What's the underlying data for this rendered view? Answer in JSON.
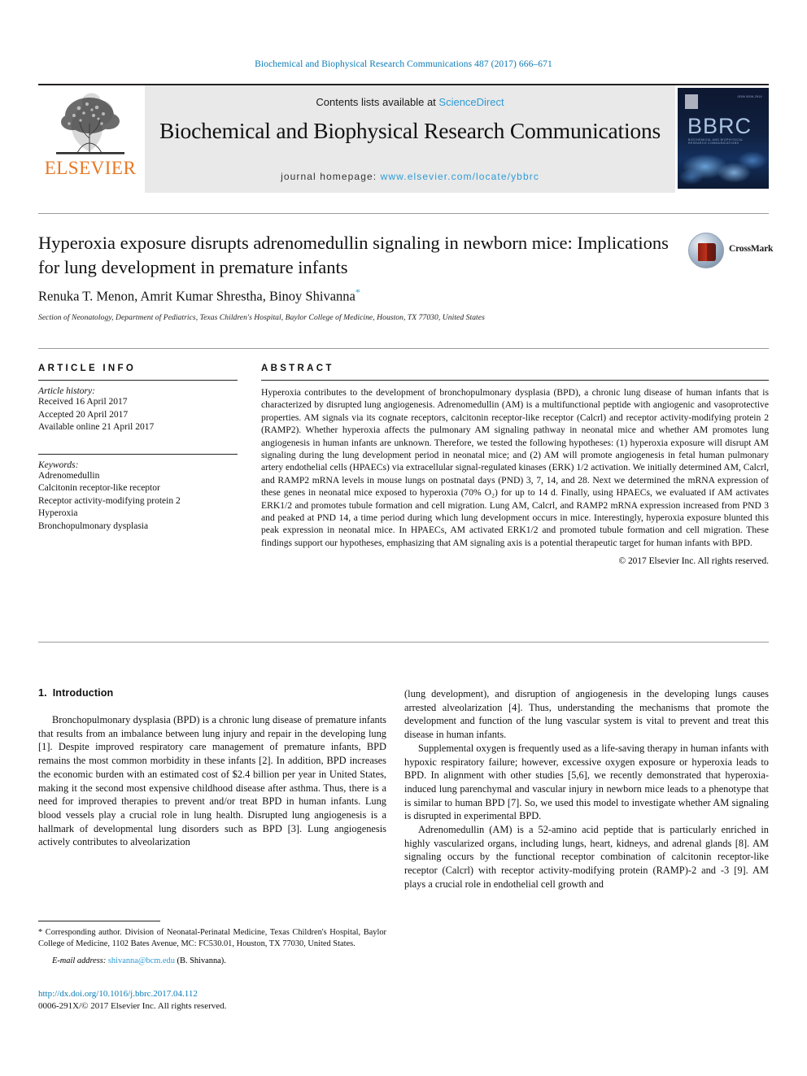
{
  "running_head": "Biochemical and Biophysical Research Communications 487 (2017) 666–671",
  "masthead": {
    "publisher_name": "ELSEVIER",
    "contents_prefix": "Contents lists available at ",
    "sciencedirect": "ScienceDirect",
    "journal_title": "Biochemical and Biophysical Research Communications",
    "homepage_prefix": "journal homepage: ",
    "homepage_url": "www.elsevier.com/locate/ybbrc",
    "cover": {
      "acronym": "BBRC",
      "subtitle": "BIOCHEMICAL AND BIOPHYSICAL RESEARCH COMMUNICATIONS",
      "corner_note": "ISSN 0006-291X"
    }
  },
  "article": {
    "title": "Hyperoxia exposure disrupts adrenomedullin signaling in newborn mice: Implications for lung development in premature infants",
    "authors": "Renuka T. Menon, Amrit Kumar Shrestha, Binoy Shivanna",
    "corresponding_marker": "*",
    "affiliation": "Section of Neonatology, Department of Pediatrics, Texas Children's Hospital, Baylor College of Medicine, Houston, TX 77030, United States",
    "crossmark_label": "CrossMark"
  },
  "article_info": {
    "heading": "ARTICLE INFO",
    "history_label": "Article history:",
    "history": [
      "Received 16 April 2017",
      "Accepted 20 April 2017",
      "Available online 21 April 2017"
    ],
    "keywords_label": "Keywords:",
    "keywords": [
      "Adrenomedullin",
      "Calcitonin receptor-like receptor",
      "Receptor activity-modifying protein 2",
      "Hyperoxia",
      "Bronchopulmonary dysplasia"
    ]
  },
  "abstract": {
    "heading": "ABSTRACT",
    "text": "Hyperoxia contributes to the development of bronchopulmonary dysplasia (BPD), a chronic lung disease of human infants that is characterized by disrupted lung angiogenesis. Adrenomedullin (AM) is a multifunctional peptide with angiogenic and vasoprotective properties. AM signals via its cognate receptors, calcitonin receptor-like receptor (Calcrl) and receptor activity-modifying protein 2 (RAMP2). Whether hyperoxia affects the pulmonary AM signaling pathway in neonatal mice and whether AM promotes lung angiogenesis in human infants are unknown. Therefore, we tested the following hypotheses: (1) hyperoxia exposure will disrupt AM signaling during the lung development period in neonatal mice; and (2) AM will promote angiogenesis in fetal human pulmonary artery endothelial cells (HPAECs) via extracellular signal-regulated kinases (ERK) 1/2 activation. We initially determined AM, Calcrl, and RAMP2 mRNA levels in mouse lungs on postnatal days (PND) 3, 7, 14, and 28. Next we determined the mRNA expression of these genes in neonatal mice exposed to hyperoxia (70% O₂) for up to 14 d. Finally, using HPAECs, we evaluated if AM activates ERK1/2 and promotes tubule formation and cell migration. Lung AM, Calcrl, and RAMP2 mRNA expression increased from PND 3 and peaked at PND 14, a time period during which lung development occurs in mice. Interestingly, hyperoxia exposure blunted this peak expression in neonatal mice. In HPAECs, AM activated ERK1/2 and promoted tubule formation and cell migration. These findings support our hypotheses, emphasizing that AM signaling axis is a potential therapeutic target for human infants with BPD.",
    "copyright": "© 2017 Elsevier Inc. All rights reserved."
  },
  "body": {
    "section_number": "1.",
    "section_title": "Introduction",
    "left_paragraphs": [
      "Bronchopulmonary dysplasia (BPD) is a chronic lung disease of premature infants that results from an imbalance between lung injury and repair in the developing lung [1]. Despite improved respiratory care management of premature infants, BPD remains the most common morbidity in these infants [2]. In addition, BPD increases the economic burden with an estimated cost of $2.4 billion per year in United States, making it the second most expensive childhood disease after asthma. Thus, there is a need for improved therapies to prevent and/or treat BPD in human infants. Lung blood vessels play a crucial role in lung health. Disrupted lung angiogenesis is a hallmark of developmental lung disorders such as BPD [3]. Lung angiogenesis actively contributes to alveolarization"
    ],
    "right_paragraphs": [
      "(lung development), and disruption of angiogenesis in the developing lungs causes arrested alveolarization [4]. Thus, understanding the mechanisms that promote the development and function of the lung vascular system is vital to prevent and treat this disease in human infants.",
      "Supplemental oxygen is frequently used as a life-saving therapy in human infants with hypoxic respiratory failure; however, excessive oxygen exposure or hyperoxia leads to BPD. In alignment with other studies [5,6], we recently demonstrated that hyperoxia-induced lung parenchymal and vascular injury in newborn mice leads to a phenotype that is similar to human BPD [7]. So, we used this model to investigate whether AM signaling is disrupted in experimental BPD.",
      "Adrenomedullin (AM) is a 52-amino acid peptide that is particularly enriched in highly vascularized organs, including lungs, heart, kidneys, and adrenal glands [8]. AM signaling occurs by the functional receptor combination of calcitonin receptor-like receptor (Calcrl) with receptor activity-modifying protein (RAMP)-2 and -3 [9]. AM plays a crucial role in endothelial cell growth and"
    ]
  },
  "footnote": {
    "corresponding": "* Corresponding author. Division of Neonatal-Perinatal Medicine, Texas Children's Hospital, Baylor College of Medicine, 1102 Bates Avenue, MC: FC530.01, Houston, TX 77030, United States.",
    "email_label": "E-mail address:",
    "email": "shivanna@bcm.edu",
    "email_owner": "(B. Shivanna)."
  },
  "colophon": {
    "doi": "http://dx.doi.org/10.1016/j.bbrc.2017.04.112",
    "issn_line": "0006-291X/© 2017 Elsevier Inc. All rights reserved."
  },
  "colors": {
    "link_blue": "#2e9bd6",
    "header_blue": "#0b7ab5",
    "elsevier_orange": "#e87722",
    "band_gray": "#e9e9e9"
  }
}
